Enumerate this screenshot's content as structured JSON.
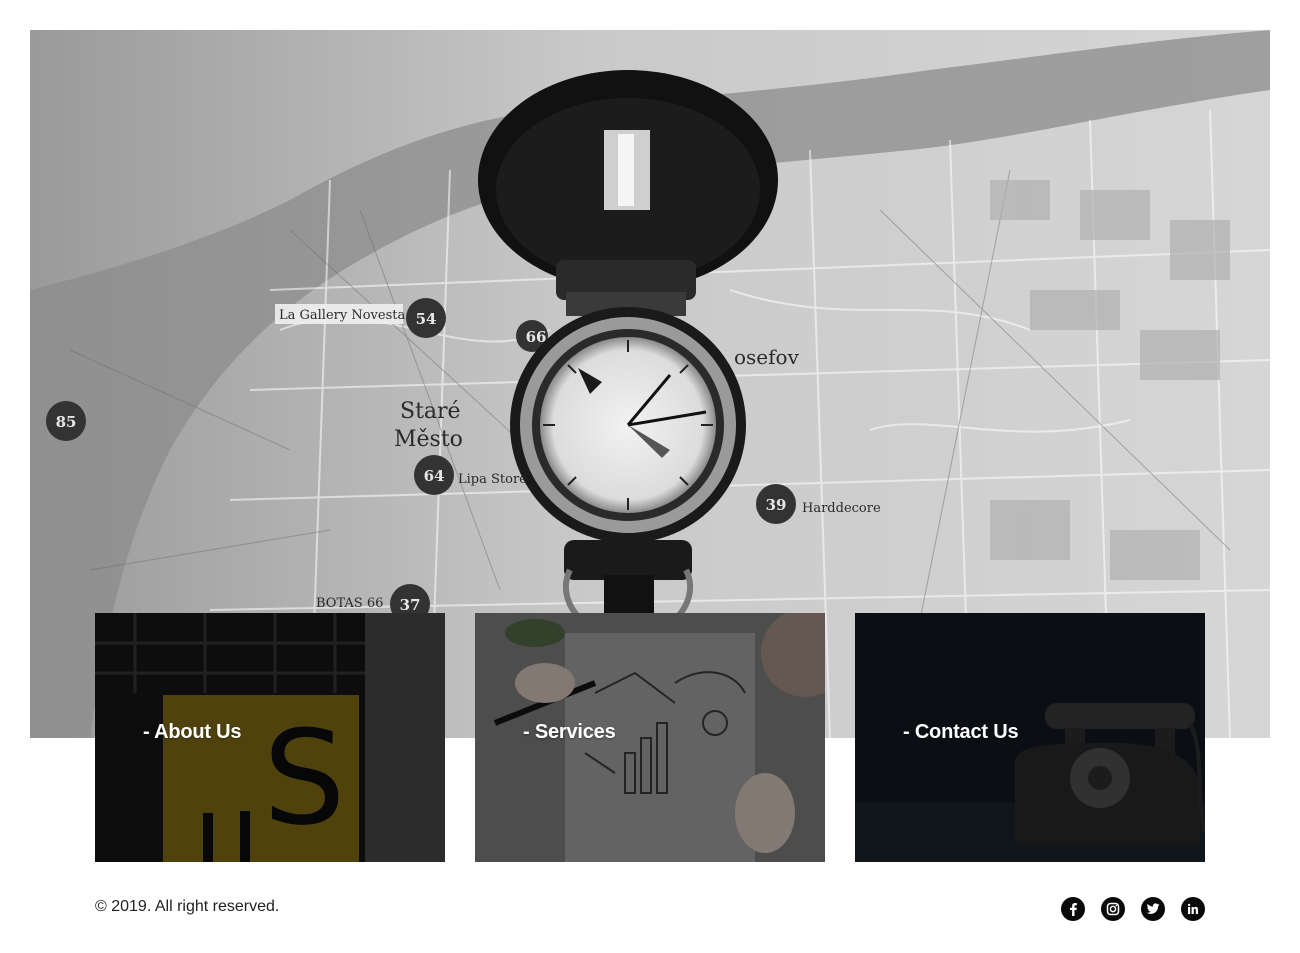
{
  "hero": {
    "image": "map-with-compass",
    "map_labels": {
      "gallery": "La Gallery Novesta",
      "stare_mesto_1": "Staré",
      "stare_mesto_2": "Město",
      "lipa": "Lipa Store",
      "harddecore": "Harddecore",
      "botas": "BOTAS 66",
      "josefov": "osefov"
    },
    "map_markers": [
      "54",
      "66",
      "85",
      "64",
      "39",
      "37"
    ]
  },
  "cards": [
    {
      "title": "- About Us",
      "image": "yellow-sign-us"
    },
    {
      "title": "- Services",
      "image": "business-sketch-notebook"
    },
    {
      "title": "- Contact Us",
      "image": "vintage-telephone"
    }
  ],
  "footer": {
    "copyright": "© 2019. All right reserved.",
    "social": [
      {
        "name": "facebook-icon"
      },
      {
        "name": "instagram-icon"
      },
      {
        "name": "twitter-icon"
      },
      {
        "name": "linkedin-icon"
      }
    ]
  },
  "colors": {
    "icon_bg": "#0a0a0a",
    "card_text": "#ffffff",
    "footer_text": "#222222"
  }
}
